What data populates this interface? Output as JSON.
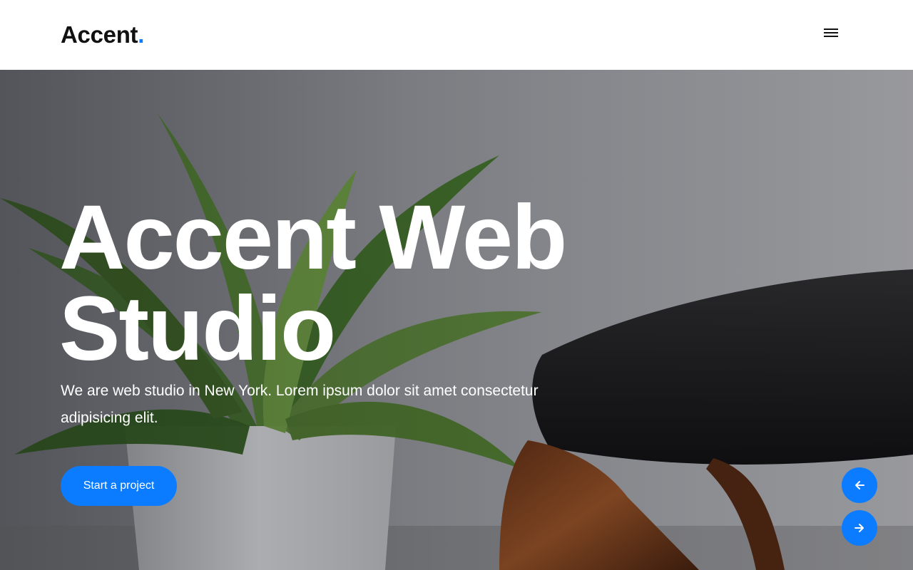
{
  "header": {
    "logo_text": "Accent",
    "logo_dot": ".",
    "menu_icon": "hamburger-menu-icon"
  },
  "hero": {
    "title_line1": "Accent Web",
    "title_line2": "Studio",
    "description": "We are web studio in New York. Lorem ipsum dolor sit amet consectetur adipisicing elit.",
    "cta_label": "Start a project",
    "prev_icon": "arrow-left-icon",
    "next_icon": "arrow-right-icon",
    "background": "photo of a potted green plant in a white pot beside a black leather and wood chair"
  },
  "colors": {
    "accent": "#0b7cff",
    "header_bg": "#ffffff",
    "logo_text": "#111111",
    "hero_text": "#ffffff"
  }
}
